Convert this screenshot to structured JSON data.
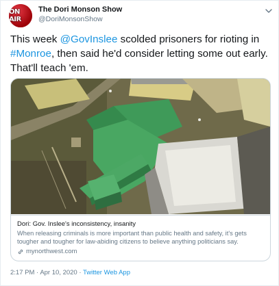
{
  "author": {
    "display_name": "The Dori Monson Show",
    "handle": "@DoriMonsonShow",
    "avatar_text": "ON AIR"
  },
  "tweet": {
    "text_before_mention1": "This week ",
    "mention": "@GovInslee",
    "text_after_mention": " scolded prisoners for rioting in ",
    "hashtag": "#Monroe",
    "text_after_hashtag": ", then said he'd consider letting some out early. That'll teach 'em."
  },
  "card": {
    "title": "Dori: Gov. Inslee's inconsistency, insanity",
    "description": "When releasing criminals is more important than public health and safety, it's gets tougher and tougher for law-abiding citizens to believe anything politicians say.",
    "domain": "mynorthwest.com"
  },
  "meta": {
    "time": "2:17 PM",
    "separator1": " · ",
    "date": "Apr 10, 2020",
    "separator2": " · ",
    "app": "Twitter Web App"
  },
  "colors": {
    "link": "#1b95e0",
    "secondary_text": "#657786",
    "avatar_red": "#c1121f"
  },
  "icons": {
    "caret": "chevron-down-icon",
    "link": "link-icon"
  }
}
